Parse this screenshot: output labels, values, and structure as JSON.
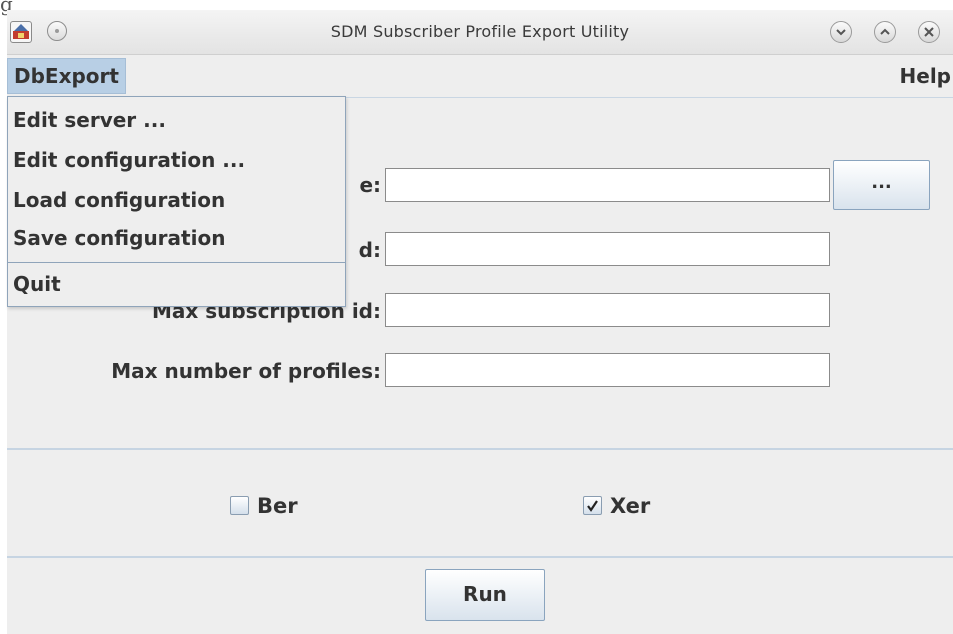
{
  "window": {
    "title": "SDM Subscriber Profile Export Utility"
  },
  "icons": {
    "app": "app-icon",
    "window_menu": "window-menu-icon",
    "minimize": "minimize-icon",
    "maximize": "maximize-icon",
    "close": "close-icon"
  },
  "menubar": {
    "menus": [
      {
        "label": "DbExport"
      },
      {
        "label": "Help"
      }
    ]
  },
  "dropdown": {
    "items": [
      {
        "label": "Edit server ..."
      },
      {
        "label": "Edit configuration ..."
      },
      {
        "label": "Load configuration"
      },
      {
        "label": "Save configuration"
      },
      {
        "label": "Quit"
      }
    ]
  },
  "form": {
    "rows": [
      {
        "label_visible": "e:",
        "value": ""
      },
      {
        "label_visible": "d:",
        "value": ""
      },
      {
        "label_visible": "Max subscription id:",
        "value": ""
      },
      {
        "label_visible": "Max number of profiles:",
        "value": ""
      }
    ],
    "browse_label": "..."
  },
  "options": {
    "ber": {
      "label": "Ber",
      "checked": false
    },
    "xer": {
      "label": "Xer",
      "checked": true
    }
  },
  "actions": {
    "run_label": "Run"
  },
  "colors": {
    "window_bg": "#eeeeee",
    "menu_selected_bg": "#b8cfe5",
    "separator": "#c6d4e2",
    "text": "#333333"
  }
}
